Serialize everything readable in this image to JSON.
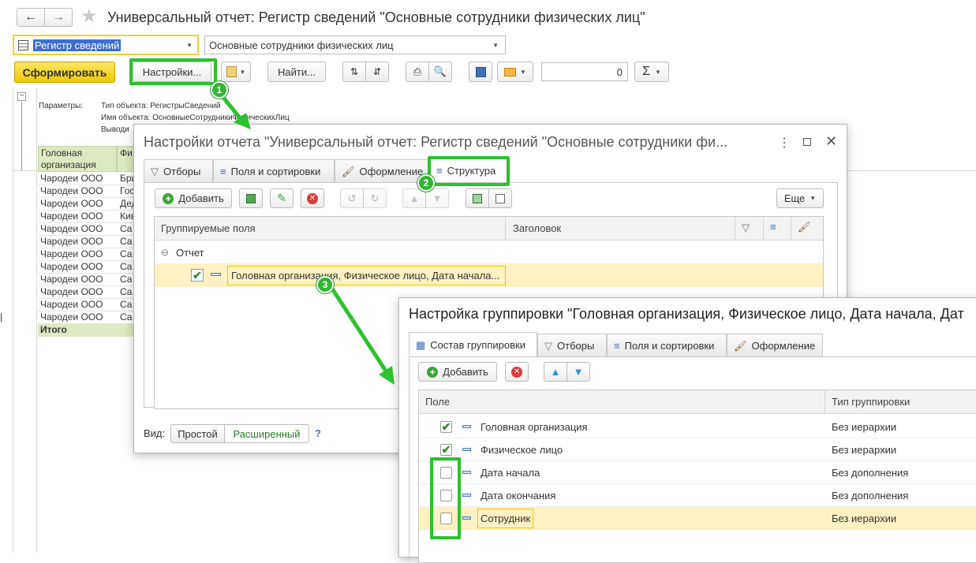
{
  "window": {
    "title": "Универсальный отчет: Регистр сведений \"Основные сотрудники физических лиц\""
  },
  "top": {
    "object_type": "Регистр сведений",
    "object_name": "Основные сотрудники физических лиц",
    "generate_label": "Сформировать",
    "settings_label": "Настройки...",
    "find_label": "Найти...",
    "sum_value": "0"
  },
  "report": {
    "params_label": "Параметры:",
    "param1": "Тип объекта: РегистрыСведений",
    "param2": "Имя объекта: ОсновныеСотрудникиФизическихЛиц",
    "param3": "Выводи",
    "col1_header": "Головная организация",
    "col2_header": "Фи",
    "rows": [
      {
        "org": "Чародеи ООО",
        "p": "Бри"
      },
      {
        "org": "Чародеи ООО",
        "p": "Гос"
      },
      {
        "org": "Чародеи ООО",
        "p": "Дед"
      },
      {
        "org": "Чародеи ООО",
        "p": "Кив"
      },
      {
        "org": "Чародеи ООО",
        "p": "Са"
      },
      {
        "org": "Чародеи ООО",
        "p": "Са"
      },
      {
        "org": "Чародеи ООО",
        "p": "Са"
      },
      {
        "org": "Чародеи ООО",
        "p": "Са"
      },
      {
        "org": "Чародеи ООО",
        "p": "Са"
      },
      {
        "org": "Чародеи ООО",
        "p": "Са"
      },
      {
        "org": "Чародеи ООО",
        "p": "Са"
      },
      {
        "org": "Чародеи ООО",
        "p": "Са"
      },
      {
        "org": "Чародеи ООО",
        "p": "Ше"
      }
    ],
    "total_label": "Итого"
  },
  "dialog1": {
    "title": "Настройки отчета \"Универсальный отчет: Регистр сведений \"Основные сотрудники фи...",
    "tabs": [
      "Отборы",
      "Поля и сортировки",
      "Оформление",
      "Структура"
    ],
    "add_label": "Добавить",
    "more_label": "Еще",
    "col_grouped": "Группируемые поля",
    "col_header": "Заголовок",
    "root_label": "Отчет",
    "group_row": "Головная организация, Физическое лицо, Дата начала...",
    "view_label": "Вид:",
    "view_simple": "Простой",
    "view_extended": "Расширенный",
    "help": "?"
  },
  "dialog2": {
    "title": "Настройка группировки \"Головная организация, Физическое лицо, Дата начала, Дат",
    "tabs": [
      "Состав группировки",
      "Отборы",
      "Поля и сортировки",
      "Оформление"
    ],
    "add_label": "Добавить",
    "col_field": "Поле",
    "col_type": "Тип группировки",
    "rows": [
      {
        "field": "Головная организация",
        "type": "Без иерархии",
        "checked": true
      },
      {
        "field": "Физическое лицо",
        "type": "Без иерархии",
        "checked": true
      },
      {
        "field": "Дата начала",
        "type": "Без дополнения",
        "checked": false
      },
      {
        "field": "Дата окончания",
        "type": "Без дополнения",
        "checked": false
      },
      {
        "field": "Сотрудник",
        "type": "Без иерархии",
        "checked": false
      }
    ]
  },
  "annotations": {
    "step1": "1",
    "step2": "2",
    "step3": "3"
  },
  "colors": {
    "accent_green": "#2dc12d",
    "generate_yellow": "#f5d21f",
    "selected_row": "#fff1c2"
  }
}
